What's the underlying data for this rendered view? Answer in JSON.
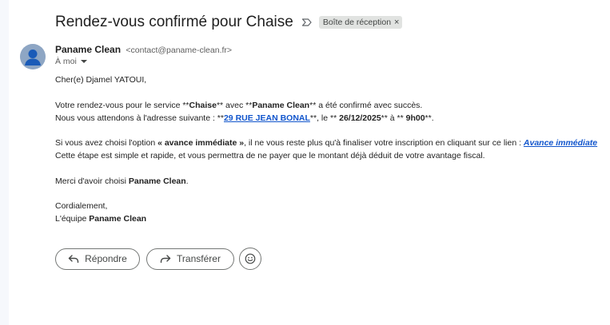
{
  "email": {
    "subject": "Rendez-vous confirmé pour Chaise",
    "label": "Boîte de réception",
    "label_remove": "×",
    "sender_name": "Paname Clean",
    "sender_email": "<contact@paname-clean.fr>",
    "recipient": "À moi"
  },
  "body": {
    "greeting": "Cher(e) Djamel YATOUI,",
    "l1_a": "Votre rendez-vous pour le service **",
    "l1_service": "Chaise",
    "l1_b": "** avec **",
    "l1_company": "Paname Clean",
    "l1_c": "** a été confirmé avec succès.",
    "l2_a": "Nous vous attendons à l'adresse suivante : **",
    "l2_address": "29 RUE JEAN BONAL",
    "l2_b": "**, le ** ",
    "l2_date": "26/12/2025",
    "l2_c": "** à ** ",
    "l2_time": "9h00",
    "l2_d": "**.",
    "l3_a": "Si vous avez choisi l'option ",
    "l3_option": "« avance immédiate »",
    "l3_b": ", il ne vous reste plus qu'à finaliser votre inscription en cliquant sur ce lien : ",
    "l3_link": "Avance immédiate",
    "l4": "Cette étape est simple et rapide, et vous permettra de ne payer que le montant déjà déduit de votre avantage fiscal.",
    "l5_a": "Merci d'avoir choisi ",
    "l5_company": "Paname Clean",
    "l5_b": ".",
    "closing": "Cordialement,",
    "sig_a": "L'équipe ",
    "sig_company": "Paname Clean"
  },
  "actions": {
    "reply_label": "Répondre",
    "forward_label": "Transférer"
  },
  "icons": {
    "importance": "importance-marker-icon",
    "reply": "reply-arrow-icon",
    "forward": "forward-arrow-icon",
    "emoji": "smiley-face-icon",
    "avatar": "default-person-avatar"
  }
}
